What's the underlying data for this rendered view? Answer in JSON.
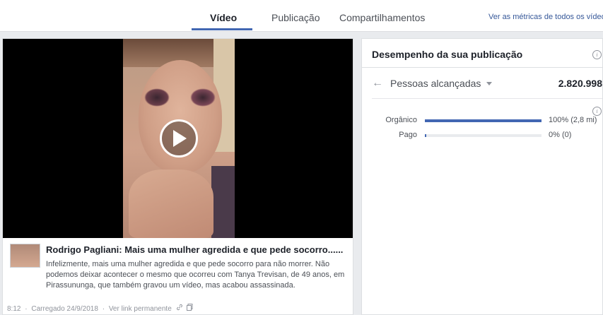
{
  "tabs": [
    {
      "label": "Vídeo",
      "active": true
    },
    {
      "label": "Publicação",
      "active": false
    },
    {
      "label": "Compartilhamentos",
      "active": false
    }
  ],
  "metrics_link": "Ver as métricas de todos os vídeos",
  "post": {
    "title": "Rodrigo Pagliani: Mais uma mulher agredida e que pede socorro......",
    "description": "Infelizmente, mais uma mulher agredida e que pede socorro para não morrer. Não podemos deixar acontecer o mesmo que ocorreu com Tanya Trevisan, de 49 anos, em Pirassununga, que também gravou um vídeo, mas acabou assassinada.",
    "duration": "8:12",
    "uploaded": "Carregado 24/9/2018",
    "permalink": "Ver link permanente",
    "separator": "·"
  },
  "performance": {
    "title": "Desempenho da sua publicação",
    "info_glyph": "i",
    "metric_label": "Pessoas alcançadas",
    "metric_value": "2.820.998",
    "breakdown": [
      {
        "label": "Orgânico",
        "value_text": "100% (2,8 mi)",
        "fraction": 1.0
      },
      {
        "label": "Pago",
        "value_text": "0% (0)",
        "fraction": 0.0
      }
    ]
  },
  "colors": {
    "accent": "#4267b2",
    "link": "#365899",
    "background": "#e9ebee"
  },
  "icons": [
    "play-icon",
    "info-icon",
    "back-arrow-icon",
    "caret-down-icon",
    "link-icon",
    "copy-icon"
  ]
}
